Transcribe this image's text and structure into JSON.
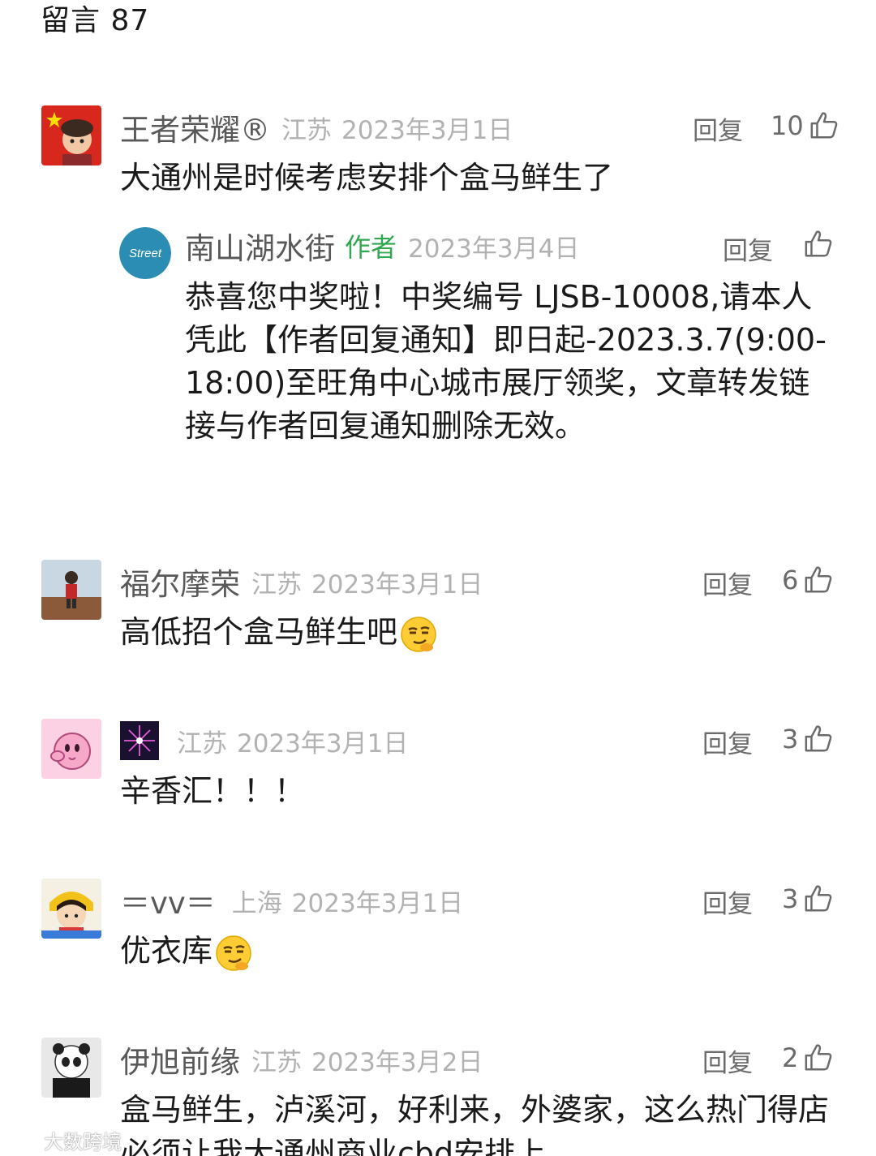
{
  "header": {
    "title": "留言 87"
  },
  "comments": [
    {
      "nickname": "王者荣耀®",
      "location": "江苏",
      "date": "2023年3月1日",
      "reply_label": "回复",
      "likes": "10",
      "text": "大通州是时候考虑安排个盒马鲜生了",
      "avatar": "child-with-flag-avatar",
      "reply": {
        "nickname": "南山湖水街",
        "author_tag": "作者",
        "date": "2023年3月4日",
        "reply_label": "回复",
        "avatar": "street-logo-avatar",
        "avatar_text": "Street",
        "text": "恭喜您中奖啦！中奖编号 LJSB-10008,请本人凭此【作者回复通知】即日起-2023.3.7(9:00-18:00)至旺角中心城市展厅领奖，文章转发链接与作者回复通知删除无效。"
      }
    },
    {
      "nickname": "福尔摩荣",
      "location": "江苏",
      "date": "2023年3月1日",
      "reply_label": "回复",
      "likes": "6",
      "text": "高低招个盒马鲜生吧",
      "emoji": "smirk-emoji",
      "avatar": "red-shirt-figure-avatar"
    },
    {
      "nickname": "",
      "location": "江苏",
      "date": "2023年3月1日",
      "reply_label": "回复",
      "likes": "3",
      "text": "辛香汇！！！",
      "avatar": "pink-kirby-avatar",
      "nickname_image": "firework-icon"
    },
    {
      "nickname": "＝vv＝",
      "location": "上海",
      "date": "2023年3月1日",
      "reply_label": "回复",
      "likes": "3",
      "text": "优衣库",
      "emoji": "smirk-emoji",
      "avatar": "cartoon-girl-avatar"
    },
    {
      "nickname": "伊旭前缘",
      "location": "江苏",
      "date": "2023年3月2日",
      "reply_label": "回复",
      "likes": "2",
      "text": "盒马鲜生，泸溪河，好利来，外婆家，这么热门得店必须让我大通州商业cbd安排上",
      "avatar": "panda-hat-avatar"
    }
  ],
  "watermark": {
    "text": "大数跨境"
  },
  "colors": {
    "author_tag": "#2fa84f",
    "meta_grey": "#b2b2b2",
    "nickname_grey": "#595959"
  }
}
